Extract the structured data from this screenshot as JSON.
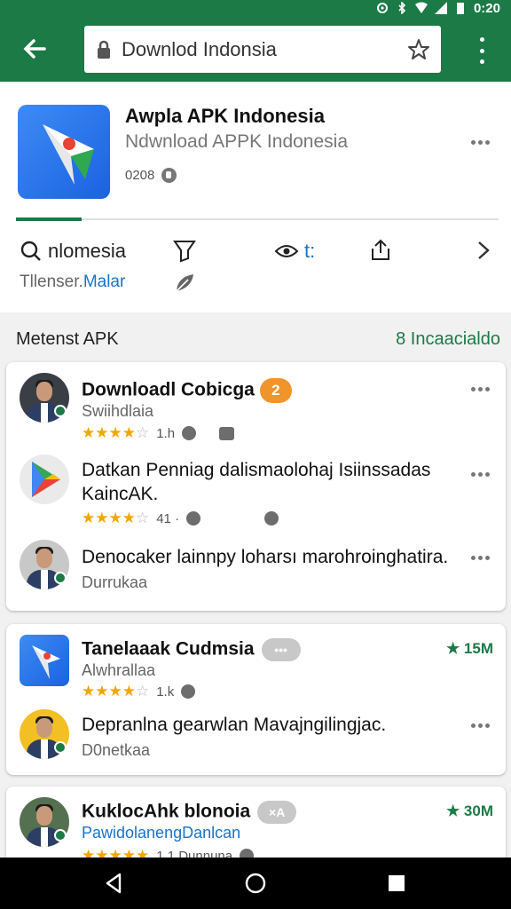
{
  "status": {
    "time": "0:20"
  },
  "search": {
    "query": "Downlod Indonsia"
  },
  "app": {
    "title": "Awpla APK Indonesia",
    "subtitle": "Ndwnload APPK Indonesia",
    "meta": "0208",
    "actions": {
      "search_label": "nlomesia",
      "cast_label": "t:"
    },
    "sub_gray": "Tllenser.",
    "sub_blue": "Malar"
  },
  "section": {
    "title": "Metenst APK",
    "link": "8 Incaacialdo"
  },
  "card1": [
    {
      "title": "Downloadl Cobicga",
      "badge": "2",
      "subtitle": "Swiihdlaia",
      "rating_text": "1.h"
    },
    {
      "title": "Datkan Penniag dalismaolohaj Isiinssadas",
      "title2": "KaincAK.",
      "rating_text": "41 ·"
    },
    {
      "title": "Denocaker lainnpy loharsı marohroinghatira.",
      "subtitle": "Durrukaa"
    }
  ],
  "card2": [
    {
      "title": "Tanelaaak Cudmsia",
      "badge": "•••",
      "subtitle": "Alwhrallaa",
      "rating_text": "1.k",
      "size": "15M"
    },
    {
      "title": "Depranlna gearwlan Mavajngilingjac.",
      "subtitle": "D0netkaa"
    }
  ],
  "card3": [
    {
      "title": "KuklocAhk blonoia",
      "badge": "×A",
      "subtitle": "PawidolanengDanlcan",
      "size": "30M",
      "rating_text": "1.1  Dunnuna"
    }
  ],
  "colors": {
    "brand": "#1b7a45",
    "star": "#f2a600",
    "badge_orange": "#f0952b",
    "link_blue": "#1a73c8"
  }
}
